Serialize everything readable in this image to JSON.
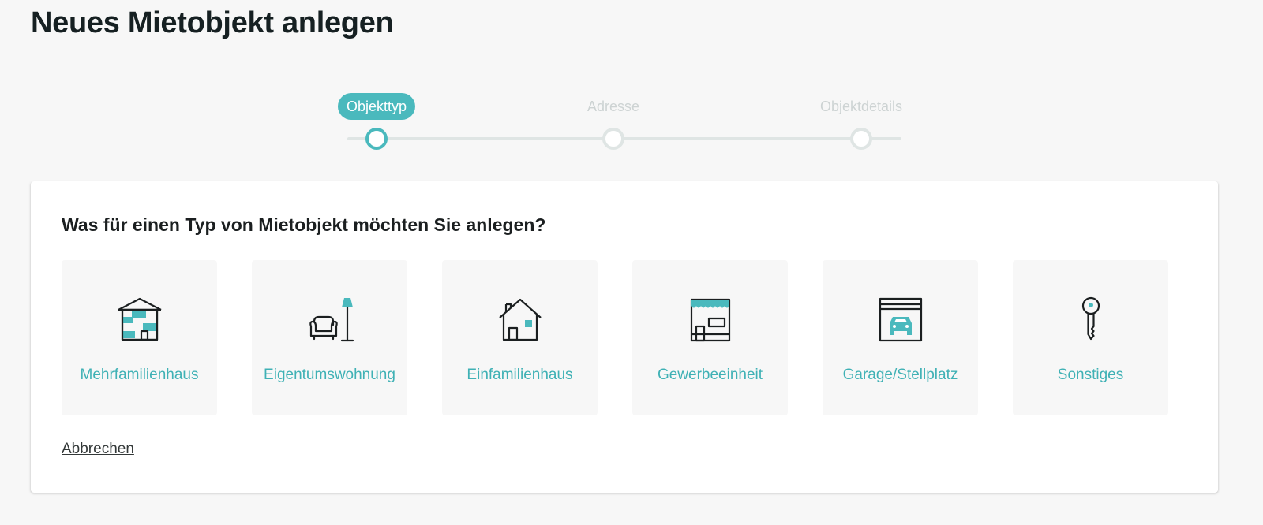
{
  "page": {
    "title": "Neues Mietobjekt anlegen"
  },
  "stepper": {
    "steps": [
      {
        "label": "Objekttyp",
        "state": "active"
      },
      {
        "label": "Adresse",
        "state": "inactive"
      },
      {
        "label": "Objektdetails",
        "state": "inactive"
      }
    ]
  },
  "card": {
    "question": "Was für einen Typ von Mietobjekt möchten Sie anlegen?",
    "types": [
      {
        "label": "Mehrfamilienhaus",
        "icon": "apartment-building-icon"
      },
      {
        "label": "Eigentumswohnung",
        "icon": "armchair-lamp-icon"
      },
      {
        "label": "Einfamilienhaus",
        "icon": "house-icon"
      },
      {
        "label": "Gewerbeeinheit",
        "icon": "storefront-icon"
      },
      {
        "label": "Garage/Stellplatz",
        "icon": "garage-car-icon"
      },
      {
        "label": "Sonstiges",
        "icon": "key-icon"
      }
    ],
    "cancel_label": "Abbrechen"
  },
  "colors": {
    "accent": "#4ab9bd",
    "accent_text": "#3fb1b5",
    "track": "#dfe5e4",
    "inactive_text": "#cdd3d3",
    "background": "#f7f7f7",
    "tile_background": "#f7f7f7"
  }
}
